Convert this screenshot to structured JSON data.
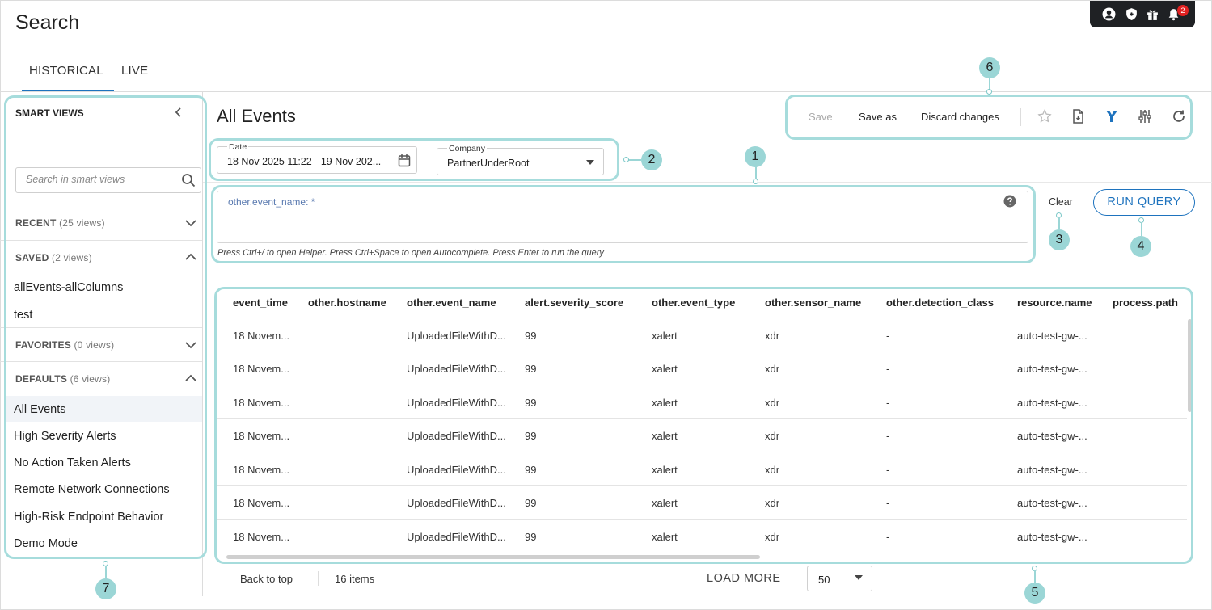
{
  "page": {
    "title": "Search"
  },
  "header": {
    "notification_count": "2"
  },
  "tabs": [
    {
      "label": "HISTORICAL"
    },
    {
      "label": "LIVE"
    }
  ],
  "sidebar": {
    "title": "SMART VIEWS",
    "search_placeholder": "Search in smart views",
    "recent": {
      "label": "RECENT",
      "count": "(25 views)"
    },
    "saved": {
      "label": "SAVED",
      "count": "(2 views)",
      "items": [
        "allEvents-allColumns",
        "test"
      ]
    },
    "favorites": {
      "label": "FAVORITES",
      "count": "(0 views)"
    },
    "defaults": {
      "label": "DEFAULTS",
      "count": "(6 views)",
      "items": [
        "All Events",
        "High Severity Alerts",
        "No Action Taken Alerts",
        "Remote Network Connections",
        "High-Risk Endpoint Behavior",
        "Demo Mode"
      ]
    }
  },
  "main": {
    "title": "All Events",
    "toolbar": {
      "save": "Save",
      "save_as": "Save as",
      "discard": "Discard changes"
    },
    "date": {
      "label": "Date",
      "value": "18 Nov 2025 11:22 - 19 Nov 202..."
    },
    "company": {
      "label": "Company",
      "value": "PartnerUnderRoot"
    },
    "query": {
      "text": "other.event_name: *",
      "hint": "Press Ctrl+/ to open Helper. Press Ctrl+Space to open Autocomplete. Press Enter to run the query"
    },
    "clear": "Clear",
    "run": "RUN QUERY"
  },
  "table": {
    "columns": [
      "event_time",
      "other.hostname",
      "other.event_name",
      "alert.severity_score",
      "other.event_type",
      "other.sensor_name",
      "other.detection_class",
      "resource.name",
      "process.path"
    ],
    "rows": [
      [
        "18 Novem...",
        "",
        "UploadedFileWithD...",
        "99",
        "xalert",
        "xdr",
        "-",
        "auto-test-gw-...",
        ""
      ],
      [
        "18 Novem...",
        "",
        "UploadedFileWithD...",
        "99",
        "xalert",
        "xdr",
        "-",
        "auto-test-gw-...",
        ""
      ],
      [
        "18 Novem...",
        "",
        "UploadedFileWithD...",
        "99",
        "xalert",
        "xdr",
        "-",
        "auto-test-gw-...",
        ""
      ],
      [
        "18 Novem...",
        "",
        "UploadedFileWithD...",
        "99",
        "xalert",
        "xdr",
        "-",
        "auto-test-gw-...",
        ""
      ],
      [
        "18 Novem...",
        "",
        "UploadedFileWithD...",
        "99",
        "xalert",
        "xdr",
        "-",
        "auto-test-gw-...",
        ""
      ],
      [
        "18 Novem...",
        "",
        "UploadedFileWithD...",
        "99",
        "xalert",
        "xdr",
        "-",
        "auto-test-gw-...",
        ""
      ],
      [
        "18 Novem...",
        "",
        "UploadedFileWithD...",
        "99",
        "xalert",
        "xdr",
        "-",
        "auto-test-gw-...",
        ""
      ]
    ]
  },
  "footer": {
    "back_to_top": "Back to top",
    "items": "16 items",
    "load_more": "LOAD MORE",
    "page_size": "50"
  },
  "callouts": [
    "1",
    "2",
    "3",
    "4",
    "5",
    "6",
    "7"
  ],
  "colors": {
    "accent": "#1e73be",
    "highlight": "#a6dcdc",
    "topbar": "#1f2124"
  },
  "icons": [
    "user-icon",
    "shield-icon",
    "gift-icon",
    "bell-icon",
    "chevron-left-icon",
    "search-icon",
    "chevron-down-icon",
    "chevron-up-icon",
    "calendar-icon",
    "caret-down-icon",
    "help-icon",
    "star-icon",
    "export-file-icon",
    "filter-icon",
    "column-settings-icon",
    "refresh-icon"
  ]
}
